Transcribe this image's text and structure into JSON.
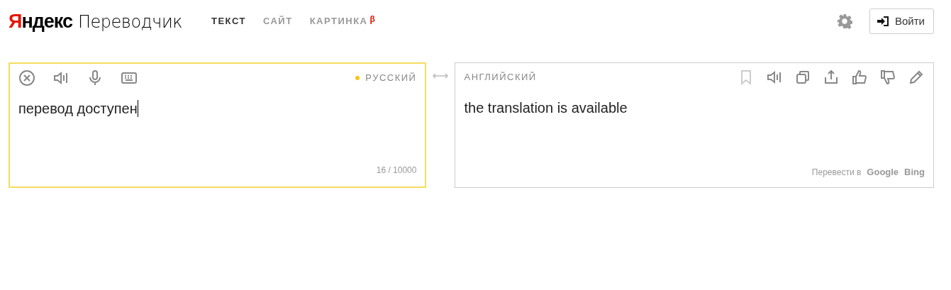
{
  "logo": {
    "brand": "Яндекс",
    "product": "Переводчик"
  },
  "tabs": [
    {
      "label": "ТЕКСТ",
      "selected": true
    },
    {
      "label": "САЙТ",
      "selected": false
    },
    {
      "label": "КАРТИНКА",
      "selected": false,
      "badge": "β"
    }
  ],
  "login_button": "Войти",
  "source": {
    "language": "РУССКИЙ",
    "detected": true,
    "text": "перевод доступен",
    "counter": "16 / 10000"
  },
  "target": {
    "language": "АНГЛИЙСКИЙ",
    "text": "the translation is available",
    "toolbar": [
      {
        "kind": "bookmark",
        "disabled": true
      },
      {
        "kind": "speaker",
        "disabled": false
      },
      {
        "kind": "copy",
        "disabled": false
      },
      {
        "kind": "share",
        "disabled": false
      },
      {
        "kind": "like",
        "disabled": false
      },
      {
        "kind": "dislike",
        "disabled": false
      },
      {
        "kind": "edit",
        "disabled": false
      }
    ],
    "translate_in": {
      "label": "Перевести в",
      "services": [
        "Google",
        "Bing"
      ]
    }
  }
}
